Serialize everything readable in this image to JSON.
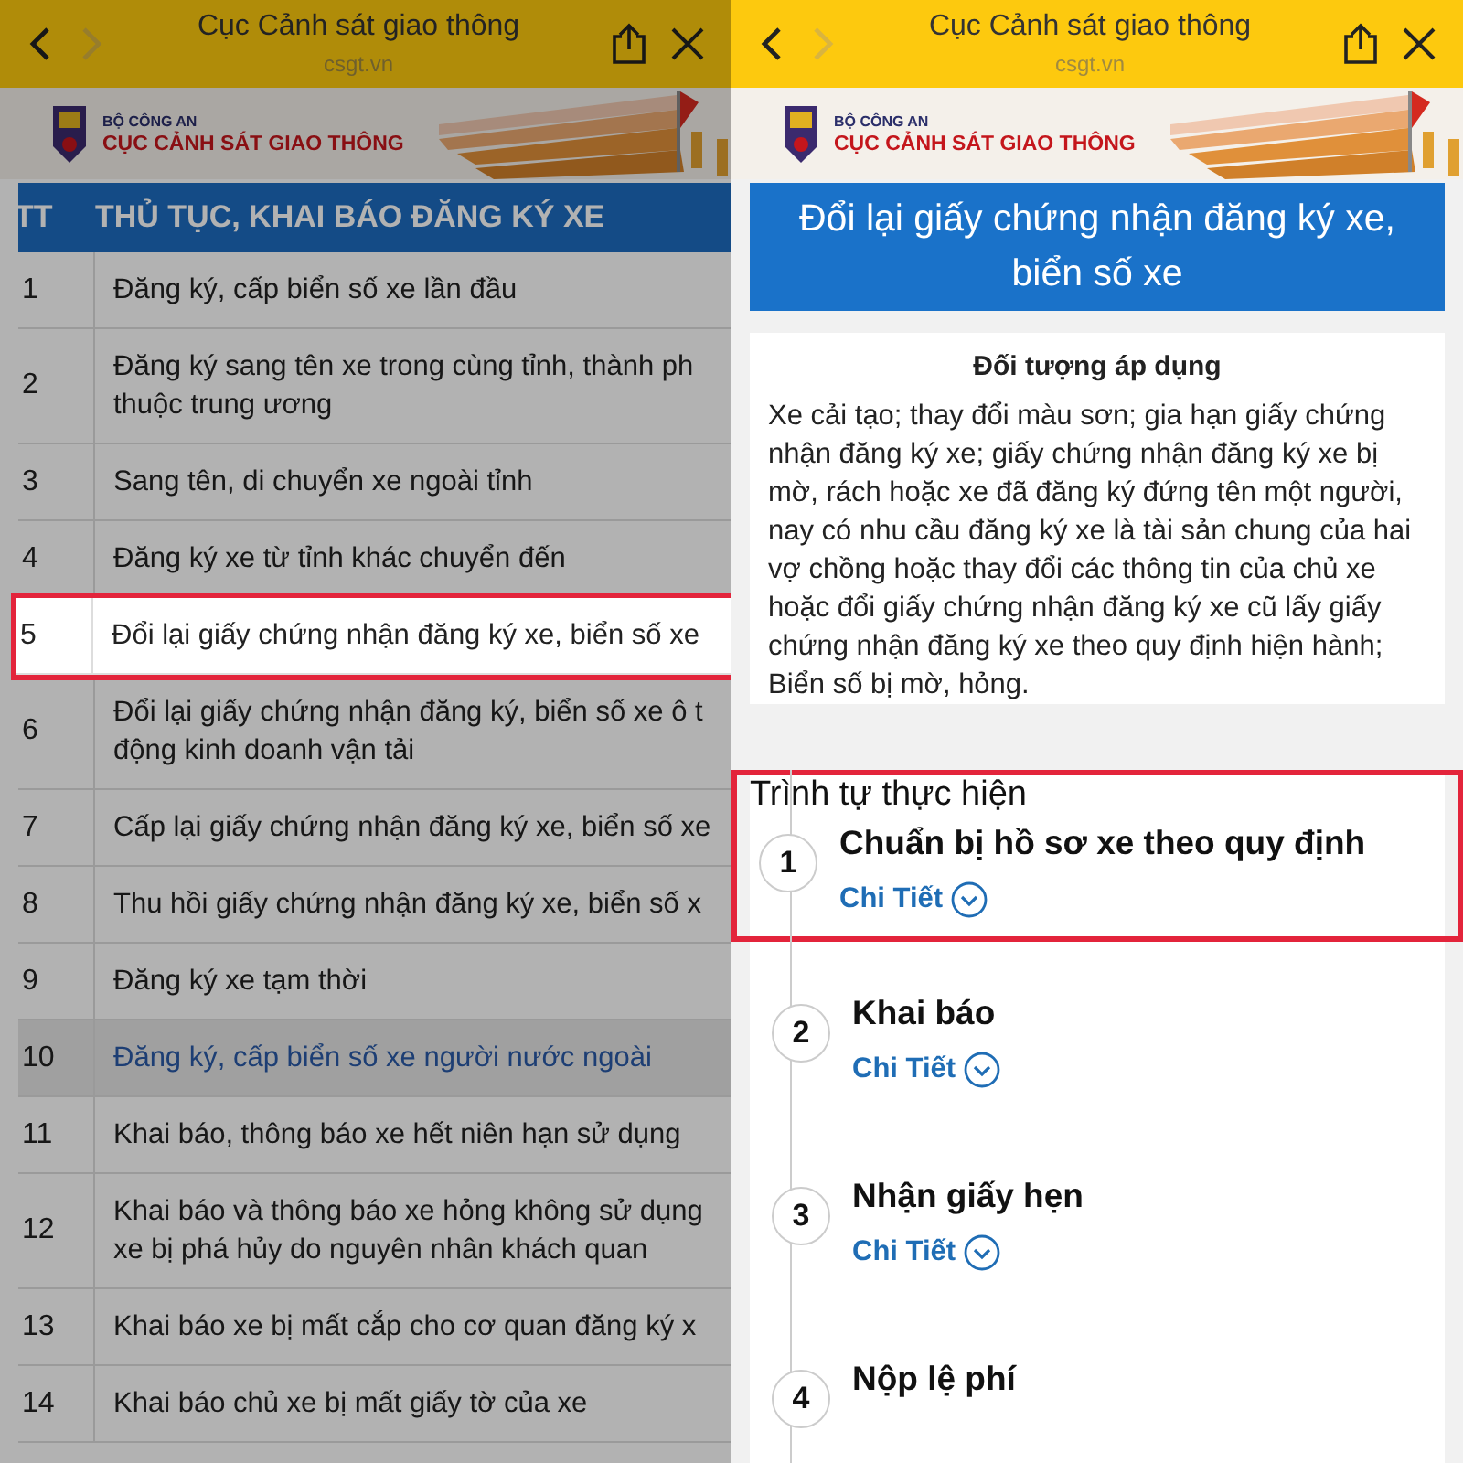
{
  "left_screen": {
    "browser_bar": {
      "title": "Cục Cảnh sát giao thông",
      "url": "csgt.vn",
      "forward_enabled": false
    },
    "banner": {
      "agency": "BỘ CÔNG AN",
      "department": "CỤC CẢNH SÁT GIAO THÔNG"
    },
    "dimmed": true,
    "table": {
      "columns": [
        "TT",
        "THỦ TỤC, KHAI BÁO ĐĂNG KÝ XE"
      ],
      "rows": [
        {
          "number": "1",
          "lines": [
            "Đăng ký, cấp biển số xe lần đầu"
          ],
          "selected": false,
          "highlighted": false
        },
        {
          "number": "2",
          "lines": [
            "Đăng ký sang tên xe trong cùng tỉnh, thành ph",
            "thuộc trung ương"
          ],
          "selected": false,
          "highlighted": false
        },
        {
          "number": "3",
          "lines": [
            "Sang tên, di chuyển xe ngoài tỉnh"
          ],
          "selected": false,
          "highlighted": false
        },
        {
          "number": "4",
          "lines": [
            "Đăng ký xe từ tỉnh khác chuyển đến"
          ],
          "selected": false,
          "highlighted": false
        },
        {
          "number": "5",
          "lines": [
            "Đổi lại giấy chứng nhận đăng ký xe, biển số xe"
          ],
          "selected": false,
          "highlighted": true
        },
        {
          "number": "6",
          "lines": [
            "Đổi lại giấy chứng nhận đăng ký, biển số xe ô t",
            "động kinh doanh vận tải"
          ],
          "selected": false,
          "highlighted": false
        },
        {
          "number": "7",
          "lines": [
            "Cấp lại giấy chứng nhận đăng ký xe, biển số xe"
          ],
          "selected": false,
          "highlighted": false
        },
        {
          "number": "8",
          "lines": [
            "Thu hồi giấy chứng nhận đăng ký xe, biển số x"
          ],
          "selected": false,
          "highlighted": false
        },
        {
          "number": "9",
          "lines": [
            "Đăng ký xe tạm thời"
          ],
          "selected": false,
          "highlighted": false
        },
        {
          "number": "10",
          "lines": [
            "Đăng ký, cấp biển số xe người nước ngoài"
          ],
          "selected": true,
          "highlighted": false
        },
        {
          "number": "11",
          "lines": [
            "Khai báo, thông báo xe hết niên hạn sử dụng"
          ],
          "selected": false,
          "highlighted": false
        },
        {
          "number": "12",
          "lines": [
            "Khai báo và thông báo xe hỏng không sử dụng",
            "xe bị phá hủy do nguyên nhân khách quan"
          ],
          "selected": false,
          "highlighted": false
        },
        {
          "number": "13",
          "lines": [
            "Khai báo xe bị mất cắp cho cơ quan đăng ký x"
          ],
          "selected": false,
          "highlighted": false
        },
        {
          "number": "14",
          "lines": [
            "Khai báo chủ xe bị mất giấy tờ của xe"
          ],
          "selected": false,
          "highlighted": false
        }
      ]
    }
  },
  "right_screen": {
    "browser_bar": {
      "title": "Cục Cảnh sát giao thông",
      "url": "csgt.vn",
      "forward_enabled": false
    },
    "banner": {
      "agency": "BỘ CÔNG AN",
      "department": "CỤC CẢNH SÁT GIAO THÔNG"
    },
    "dimmed": false,
    "title_lines": [
      "Đổi lại giấy chứng nhận đăng ký xe,",
      "biển số xe"
    ],
    "applicability": {
      "heading": "Đối tượng áp dụng",
      "text": "Xe cải tạo; thay đổi màu sơn; gia hạn giấy chứng nhận đăng ký xe; giấy chứng nhận đăng ký xe bị mờ, rách hoặc xe đã đăng ký đứng tên một người, nay có nhu cầu đăng ký xe là tài sản chung của hai vợ chồng hoặc thay đổi các thông tin của chủ xe hoặc đổi giấy chứng nhận đăng ký xe cũ lấy giấy chứng nhận đăng ký xe theo quy định hiện hành; Biển số bị mờ, hỏng."
    },
    "procedure": {
      "heading": "Trình tự thực hiện",
      "steps": [
        {
          "number": "1",
          "title": "Chuẩn bị hồ sơ xe theo quy định",
          "link": "Chi Tiết",
          "highlighted": true
        },
        {
          "number": "2",
          "title": "Khai báo",
          "link": "Chi Tiết",
          "highlighted": false
        },
        {
          "number": "3",
          "title": "Nhận giấy hẹn",
          "link": "Chi Tiết",
          "highlighted": false
        },
        {
          "number": "4",
          "title": "Nộp lệ phí",
          "highlighted": false
        }
      ]
    }
  }
}
